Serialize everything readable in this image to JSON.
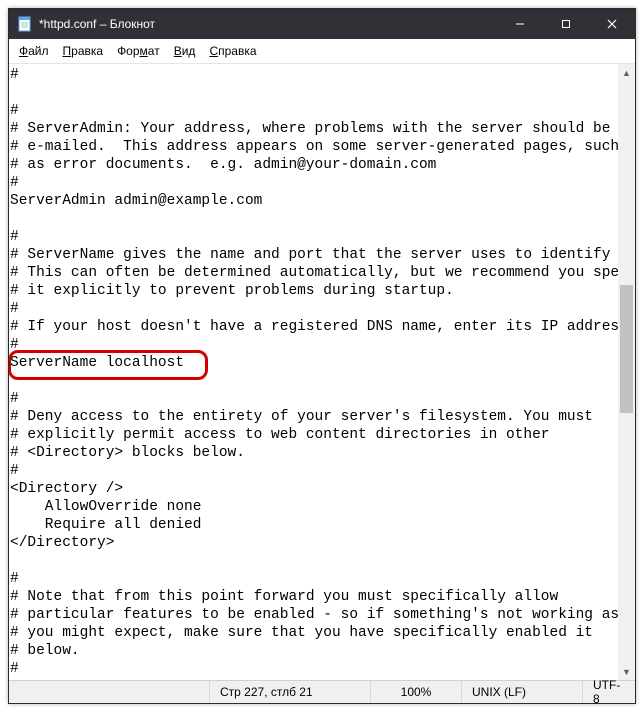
{
  "titlebar": {
    "title": "*httpd.conf – Блокнот"
  },
  "menu": {
    "file": "Файл",
    "edit": "Правка",
    "format": "Формат",
    "view": "Вид",
    "help": "Справка"
  },
  "editor": {
    "text": "#\n\n#\n# ServerAdmin: Your address, where problems with the server should be\n# e-mailed.  This address appears on some server-generated pages, such\n# as error documents.  e.g. admin@your-domain.com\n#\nServerAdmin admin@example.com\n\n#\n# ServerName gives the name and port that the server uses to identify itse\n# This can often be determined automatically, but we recommend you specify\n# it explicitly to prevent problems during startup.\n#\n# If your host doesn't have a registered DNS name, enter its IP address he\n#\nServerName localhost\n\n#\n# Deny access to the entirety of your server's filesystem. You must\n# explicitly permit access to web content directories in other\n# <Directory> blocks below.\n#\n<Directory />\n    AllowOverride none\n    Require all denied\n</Directory>\n\n#\n# Note that from this point forward you must specifically allow\n# particular features to be enabled - so if something's not working as\n# you might expect, make sure that you have specifically enabled it\n# below.\n#"
  },
  "highlight": {
    "target_line": "ServerName localhost"
  },
  "status": {
    "position": "Стр 227, стлб 21",
    "zoom": "100%",
    "eol": "UNIX (LF)",
    "encoding": "UTF-8"
  }
}
